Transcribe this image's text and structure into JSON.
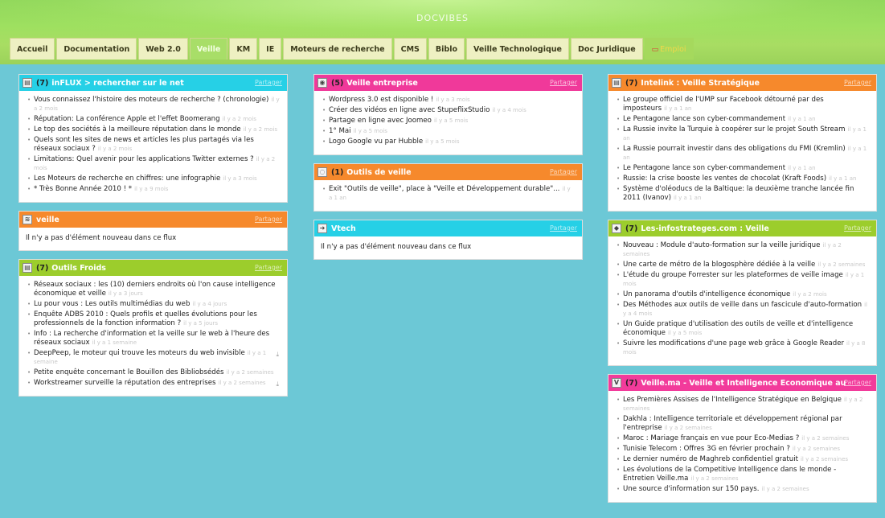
{
  "site_title": "DOCVIBES",
  "nav": [
    {
      "label": "Accueil",
      "active": false
    },
    {
      "label": "Documentation",
      "active": false
    },
    {
      "label": "Web 2.0",
      "active": false
    },
    {
      "label": "Veille",
      "active": true
    },
    {
      "label": "KM",
      "active": false
    },
    {
      "label": "IE",
      "active": false
    },
    {
      "label": "Moteurs de recherche",
      "active": false
    },
    {
      "label": "CMS",
      "active": false
    },
    {
      "label": "Biblo",
      "active": false
    },
    {
      "label": "Veille Technologique",
      "active": false
    },
    {
      "label": "Doc Juridique",
      "active": false
    },
    {
      "label": "Emploi",
      "active": false
    }
  ],
  "share_label": "Partager",
  "widgets": {
    "w1": {
      "count": "(7)",
      "title": "inFLUX > rechercher sur le net",
      "icon": "document-icon",
      "color": "#26d0e6",
      "items": [
        {
          "text": "Vous connaissez l'histoire des moteurs de recherche ? (chronologie)",
          "age": "il y a 2 mois"
        },
        {
          "text": "Réputation: La conférence Apple et l'effet Boomerang",
          "age": "il y a 2 mois"
        },
        {
          "text": "Le top des sociétés à la meilleure réputation dans le monde",
          "age": "il y a 2 mois"
        },
        {
          "text": "Quels sont les sites de news et articles les plus partagés via les réseaux sociaux ?",
          "age": "il y a 2 mois"
        },
        {
          "text": "Limitations: Quel avenir pour les applications Twitter externes ?",
          "age": "il y a 2 mois"
        },
        {
          "text": "Les Moteurs de recherche en chiffres: une infographie",
          "age": "il y a 3 mois"
        },
        {
          "text": "* Très Bonne Année 2010 ! *",
          "age": "il y a 9 mois"
        }
      ]
    },
    "w2": {
      "count": "",
      "title": "veille",
      "icon": "rss-icon",
      "color": "#f6892c",
      "empty": "Il n'y a pas d'élément nouveau dans ce flux"
    },
    "w3": {
      "count": "(7)",
      "title": "Outils Froids",
      "icon": "document-icon",
      "color": "#9ccd2c",
      "items": [
        {
          "text": "Réseaux sociaux : les (10) derniers endroits où l'on cause intelligence économique et veille",
          "age": "il y a 3 jours",
          "dl": false
        },
        {
          "text": "Lu pour vous : Les outils multimédias du web",
          "age": "il y a 4 jours",
          "dl": false
        },
        {
          "text": "Enquête ADBS 2010 : Quels profils et quelles évolutions pour les professionnels de la fonction information ?",
          "age": "il y a 5 jours",
          "dl": false
        },
        {
          "text": "Info : La recherche d'information et la veille sur le web à l'heure des réseaux sociaux",
          "age": "il y a 1 semaine",
          "dl": false
        },
        {
          "text": "DeepPeep, le moteur qui trouve les moteurs du web invisible",
          "age": "il y a 1 semaine",
          "dl": true
        },
        {
          "text": "Petite enquête concernant le Bouillon des Bibliobsédés",
          "age": "il y a 2 semaines",
          "dl": false
        },
        {
          "text": "Workstreamer surveille la réputation des entreprises",
          "age": "il y a 2 semaines",
          "dl": true
        }
      ]
    },
    "w4": {
      "count": "(5)",
      "title": "Veille entreprise",
      "icon": "globe-icon",
      "color": "#f0399a",
      "items": [
        {
          "text": "Wordpress 3.0 est disponible !",
          "age": "il y a 3 mois"
        },
        {
          "text": "Créer des vidéos en ligne avec StupeflixStudio",
          "age": "il y a 4 mois"
        },
        {
          "text": "Partage en ligne avec Joomeo",
          "age": "il y a 5 mois"
        },
        {
          "text": "1° Mai",
          "age": "il y a 5 mois"
        },
        {
          "text": "Logo Google vu par Hubble",
          "age": "il y a 5 mois"
        }
      ]
    },
    "w5": {
      "count": "(1)",
      "title": "Outils de veille",
      "icon": "chat-icon",
      "color": "#f6892c",
      "items": [
        {
          "text": "Exit \"Outils de veille\", place à \"Veille et Développement durable\"...",
          "age": "il y a 1 an"
        }
      ]
    },
    "w6": {
      "count": "",
      "title": "Vtech",
      "icon": "arrow-icon",
      "color": "#26d0e6",
      "empty": "Il n'y a pas d'élément nouveau dans ce flux"
    },
    "w7": {
      "count": "(7)",
      "title": "Intelink : Veille Stratégique",
      "icon": "document-icon",
      "color": "#f6892c",
      "items": [
        {
          "text": "Le groupe officiel de l'UMP sur Facebook détourné par des imposteurs",
          "age": "il y a 1 an"
        },
        {
          "text": "Le Pentagone lance son cyber-commandement",
          "age": "il y a 1 an"
        },
        {
          "text": "La Russie invite la Turquie à coopérer sur le projet South Stream",
          "age": "il y a 1 an"
        },
        {
          "text": "La Russie pourrait investir dans des obligations du FMI (Kremlin)",
          "age": "il y a 1 an"
        },
        {
          "text": "Le Pentagone lance son cyber-commandement",
          "age": "il y a 1 an"
        },
        {
          "text": "Russie: la crise booste les ventes de chocolat (Kraft Foods)",
          "age": "il y a 1 an"
        },
        {
          "text": "Système d'oléoducs de la Baltique: la deuxième tranche lancée fin 2011 (Ivanov)",
          "age": "il y a 1 an"
        }
      ]
    },
    "w8": {
      "count": "(7)",
      "title": "Les-infostrateges.com : Veille",
      "icon": "tag-icon",
      "color": "#9ccd2c",
      "items": [
        {
          "text": "Nouveau : Module d'auto-formation sur la veille juridique",
          "age": "il y a 2 semaines"
        },
        {
          "text": "Une carte de métro de la blogosphère dédiée à la veille",
          "age": "il y a 2 semaines"
        },
        {
          "text": "L'étude du groupe Forrester sur les plateformes de veille image",
          "age": "il y a 1 mois"
        },
        {
          "text": "Un panorama d'outils d'intelligence économique",
          "age": "il y a 2 mois"
        },
        {
          "text": "Des Méthodes aux outils de veille dans un fascicule d'auto-formation",
          "age": "il y a 4 mois"
        },
        {
          "text": "Un Guide pratique d'utilisation des outils de veille et d'intelligence économique",
          "age": "il y a 5 mois"
        },
        {
          "text": "Suivre les modifications d'une page web grâce à Google Reader",
          "age": "il y a 8 mois"
        }
      ]
    },
    "w9": {
      "count": "(7)",
      "title": "Veille.ma - Veille et Intelligence Economique au",
      "icon": "v-logo-icon",
      "color": "#f23b9b",
      "items": [
        {
          "text": "Les Premières Assises de l'Intelligence Stratégique en Belgique",
          "age": "il y a 2 semaines"
        },
        {
          "text": "Dakhla : Intelligence territoriale et développement régional par l'entreprise",
          "age": "il y a 2 semaines"
        },
        {
          "text": "Maroc : Mariage français en vue pour Eco-Medias ?",
          "age": "il y a 2 semaines"
        },
        {
          "text": "Tunisie Telecom : Offres 3G en février prochain ?",
          "age": "il y a 2 semaines"
        },
        {
          "text": "Le dernier numéro de Maghreb confidentiel gratuit",
          "age": "il y a 2 semaines"
        },
        {
          "text": "Les évolutions de la Competitive Intelligence dans le monde - Entretien Veille.ma",
          "age": "il y a 2 semaines"
        },
        {
          "text": "Une source d'information sur 150 pays.",
          "age": "il y a 2 semaines"
        }
      ]
    }
  }
}
